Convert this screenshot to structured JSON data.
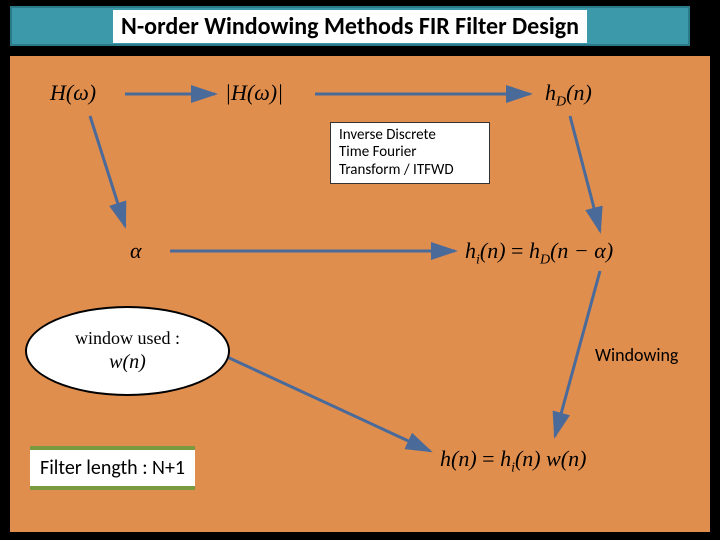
{
  "title": "N-order Windowing Methods FIR Filter Design",
  "nodes": {
    "H": "H(ω)",
    "absH": "|H(ω)|",
    "hD": "h_D(n)",
    "alpha": "α",
    "hi_eq": "h_i(n) = h_D(n − α)",
    "h_eq": "h(n) = h_i(n) w(n)"
  },
  "labels": {
    "itfwd": "Inverse Discrete\nTime Fourier\nTransform / ITFWD",
    "windowing": "Windowing",
    "filter_length": "Filter length : N+1"
  },
  "ellipse": {
    "line1": "window used :",
    "line2": "w(n)"
  }
}
